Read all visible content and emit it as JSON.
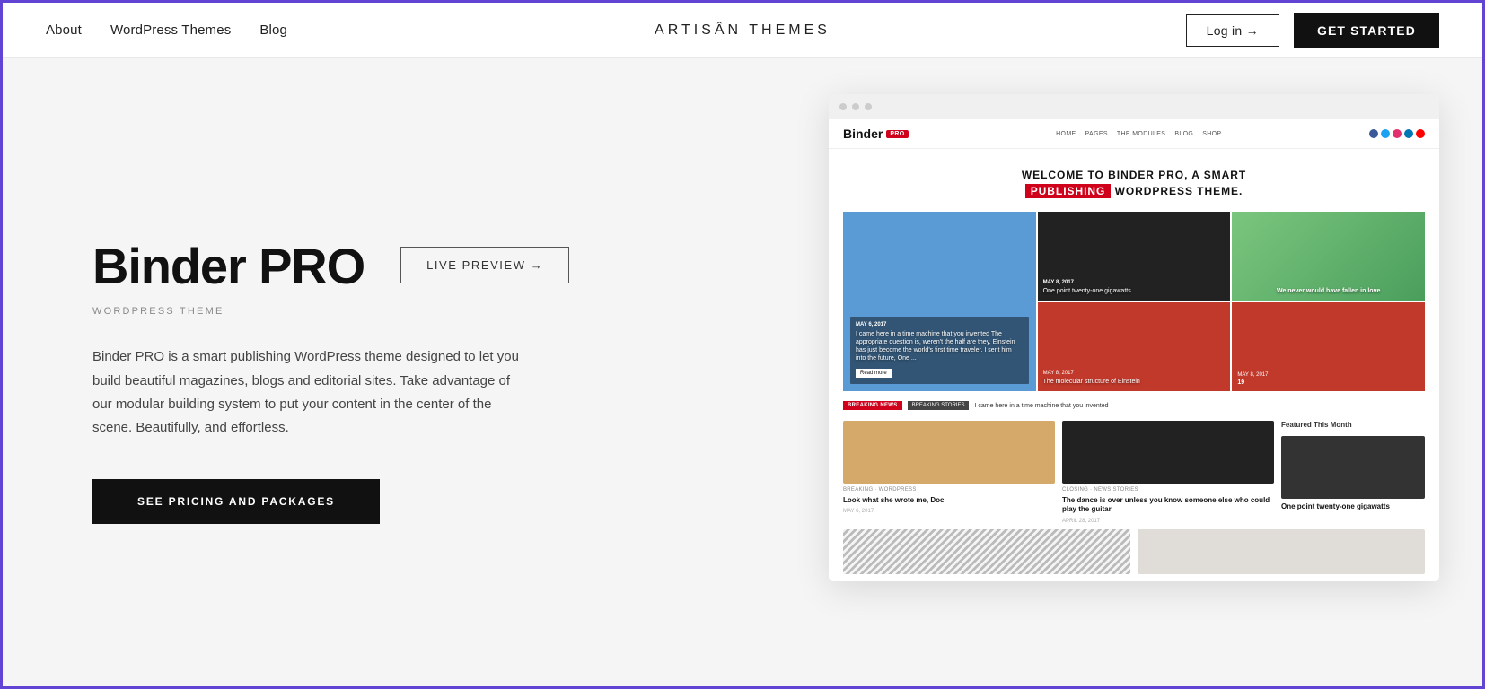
{
  "header": {
    "nav": {
      "about": "About",
      "wordpress_themes": "WordPress Themes",
      "blog": "Blog"
    },
    "logo": "ARTISÂN THEMES",
    "login_label": "Log in →",
    "get_started_label": "GET STARTED"
  },
  "hero": {
    "product_title": "Binder PRO",
    "live_preview_label": "LIVE PREVIEW →",
    "product_subtitle": "WORDPRESS THEME",
    "description": "Binder PRO is a smart publishing WordPress theme designed to let you build beautiful magazines, blogs and editorial sites. Take advantage of our modular building system to put your content in the center of the scene. Beautifully, and effortless.",
    "pricing_button": "SEE PRICING AND PACKAGES"
  },
  "mini_site": {
    "logo_text": "Binder",
    "logo_badge": "PRO",
    "nav_items": [
      "HOME",
      "PAGES",
      "THE MODULES",
      "BLOG",
      "SHOP"
    ],
    "hero_title_line1": "WELCOME TO BINDER PRO, A SMART",
    "hero_title_highlight": "PUBLISHING",
    "hero_title_line2": "WORDPRESS THEME.",
    "grid_captions": [
      "I came here in a time machine that you invented The appropriate question is, weren't the half are they. Einstein has just become the world's first time traveler. I sent him into the future, One ...",
      "One point twenty-one gigawatts",
      "We never would have fallen in love",
      "The molecular structure of Einstein"
    ],
    "breaking_news": "BREAKING NEWS",
    "breaking_tag": "BREAKING STORIES",
    "breaking_text": "I came here in a time machine that you invented",
    "articles": [
      {
        "tag": "BREAKING · WORDPRESS",
        "title": "Look what she wrote me, Doc",
        "date": "MAY 6, 2017"
      },
      {
        "tag": "CLOSING · NEWS STORIES",
        "title": "The dance is over unless you know someone else who could play the guitar",
        "date": "APRIL 28, 2017"
      }
    ],
    "featured_title": "Featured This Month",
    "featured_caption": "One point twenty-one gigawatts"
  },
  "colors": {
    "accent_purple": "#6144d3",
    "btn_dark": "#111111",
    "btn_red": "#d0021b"
  }
}
